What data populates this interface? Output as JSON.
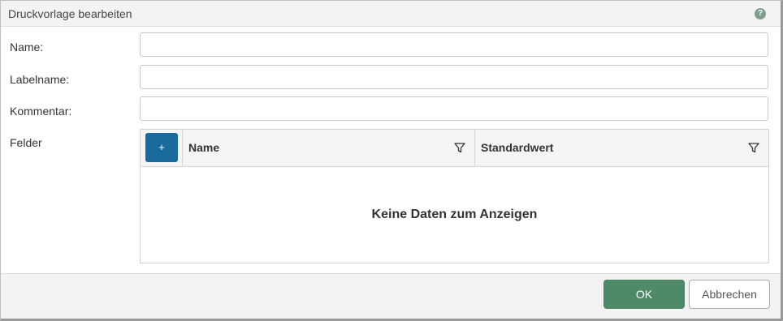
{
  "dialog": {
    "title": "Druckvorlage bearbeiten",
    "help_icon": "question-circle-icon",
    "help_symbol": "?"
  },
  "form": {
    "name": {
      "label": "Name:",
      "value": ""
    },
    "labelname": {
      "label": "Labelname:",
      "value": ""
    },
    "kommentar": {
      "label": "Kommentar:",
      "value": ""
    },
    "felder": {
      "label": "Felder"
    }
  },
  "grid": {
    "add_button_symbol": "+",
    "columns": [
      {
        "title": "Name",
        "icon": "filter-icon"
      },
      {
        "title": "Standardwert",
        "icon": "filter-icon"
      }
    ],
    "empty_text": "Keine Daten zum Anzeigen"
  },
  "footer": {
    "ok_label": "OK",
    "cancel_label": "Abbrechen"
  },
  "colors": {
    "primary_button": "#1a6a9e",
    "ok_button": "#4e8a68",
    "help_icon": "#7f9f8e"
  }
}
